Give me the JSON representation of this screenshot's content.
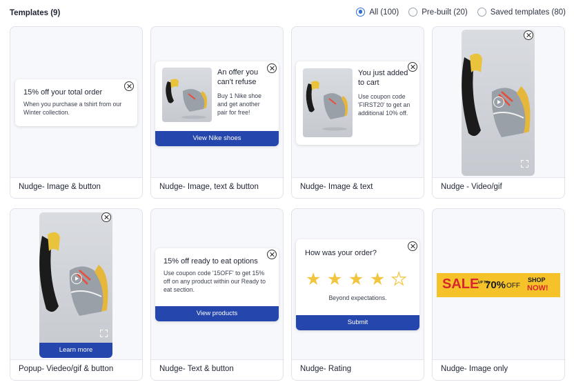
{
  "header": {
    "title": "Templates (9)",
    "filters": [
      {
        "label": "All (100)",
        "selected": true
      },
      {
        "label": "Pre-built (20)",
        "selected": false
      },
      {
        "label": "Saved templates (80)",
        "selected": false
      }
    ]
  },
  "colors": {
    "accent": "#2f6fd6",
    "button": "#2446ad",
    "star": "#f2c53f",
    "sale_bg": "#f5c22a",
    "sale_red": "#d8262c"
  },
  "cards": [
    {
      "name": "Nudge- Image & button",
      "nudge": {
        "title": "15% off your total order",
        "body": "When you purchase a tshirt from our Winter collection."
      }
    },
    {
      "name": "Nudge- Image, text & button",
      "nudge": {
        "title": "An offer you can't refuse",
        "body": "Buy 1 Nike shoe and get another pair for free!",
        "button": "View Nike shoes"
      }
    },
    {
      "name": "Nudge- Image & text",
      "nudge": {
        "title": "You just added to cart",
        "body": "Use coupon code 'FIRST20' to get an additional 10% off."
      }
    },
    {
      "name": "Nudge - Video/gif"
    },
    {
      "name": "Popup- Viedeo/gif & button",
      "nudge": {
        "button": "Learn more"
      }
    },
    {
      "name": "Nudge- Text & button",
      "nudge": {
        "title": "15% off ready to eat options",
        "body": "Use coupon code '15OFF' to get 15% off on any product within our Ready to eat section.",
        "button": "View products"
      }
    },
    {
      "name": "Nudge- Rating",
      "nudge": {
        "title": "How was your order?",
        "rating": 4,
        "rating_max": 5,
        "caption": "Beyond expectations.",
        "button": "Submit"
      }
    },
    {
      "name": "Nudge- Image only",
      "banner": {
        "sale": "SALE",
        "upto": "UP TO",
        "discount": "70%",
        "off": "OFF",
        "shop": "SHOP",
        "now": "NOW!"
      }
    }
  ]
}
